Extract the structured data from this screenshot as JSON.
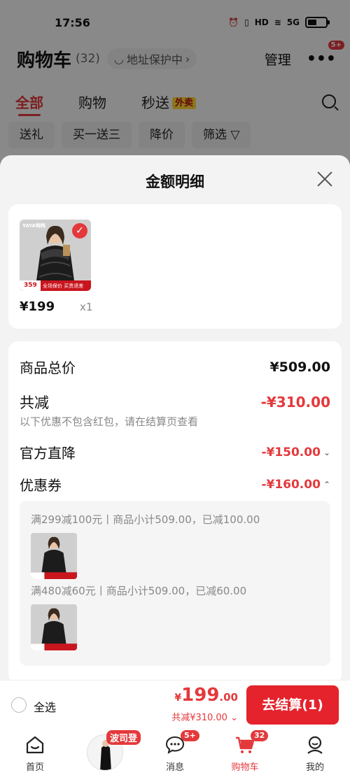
{
  "status_bar": {
    "time": "17:56",
    "network": "5G",
    "hd": "HD"
  },
  "header": {
    "title": "购物车",
    "count": "(32)",
    "address_label": "地址保护中",
    "manage_label": "管理",
    "more_badge": "5+"
  },
  "tabs": [
    {
      "label": "全部"
    },
    {
      "label": "购物"
    },
    {
      "label": "秒送",
      "tag": "外卖"
    }
  ],
  "filters": [
    "送礼",
    "买一送三",
    "降价",
    "筛选"
  ],
  "sheet": {
    "title": "金额明细",
    "product": {
      "brand": "YAYA鸭鸭",
      "thumb_price": "359",
      "thumb_banner": "全场保价 买贵退差",
      "price": "¥199",
      "qty": "x1"
    },
    "summary": {
      "total_label": "商品总价",
      "total_value": "¥509.00",
      "discount_label": "共减",
      "discount_value": "-¥310.00",
      "discount_note": "以下优惠不包含红包，请在结算页查看",
      "direct_label": "官方直降",
      "direct_value": "-¥150.00",
      "coupon_label": "优惠券",
      "coupon_value": "-¥160.00"
    },
    "coupons": [
      {
        "text": "满299减100元丨商品小计509.00，已减100.00"
      },
      {
        "text": "满480减60元丨商品小计509.00，已减60.00"
      }
    ]
  },
  "checkout": {
    "select_all_label": "全选",
    "currency": "¥",
    "price_int": "199",
    "price_dec": ".00",
    "discount_text": "共减¥310.00",
    "pay_button": "去结算(1)"
  },
  "tabbar": [
    {
      "label": "首页"
    },
    {
      "label": "波司登",
      "promo": true
    },
    {
      "label": "消息",
      "badge": "5+"
    },
    {
      "label": "购物车",
      "badge": "32",
      "active": true
    },
    {
      "label": "我的"
    }
  ],
  "colors": {
    "accent": "#e4393c",
    "button": "#e4232c"
  }
}
